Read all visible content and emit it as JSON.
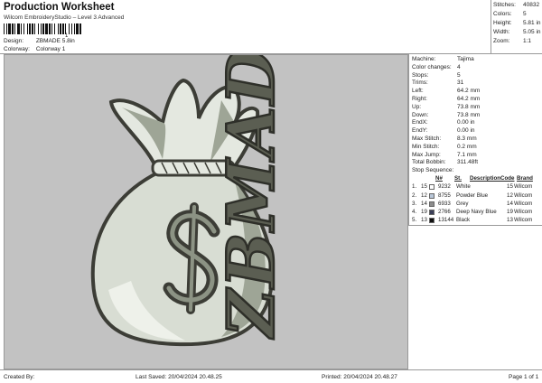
{
  "header": {
    "title": "Production Worksheet",
    "subtitle": "Wilcom EmbroideryStudio – Level 3 Advanced",
    "barcode_number": "1",
    "design_label": "Design:",
    "design_value": "ZBMADE 5.8in",
    "colorway_label": "Colorway:",
    "colorway_value": "Colorway 1"
  },
  "stats": [
    {
      "label": "Stitches:",
      "value": "40832"
    },
    {
      "label": "Colors:",
      "value": "5"
    },
    {
      "label": "Height:",
      "value": "5.81 in"
    },
    {
      "label": "Width:",
      "value": "5.05 in"
    },
    {
      "label": "Zoom:",
      "value": "1:1"
    }
  ],
  "machine_info": [
    {
      "label": "Machine:",
      "value": "Tajima"
    },
    {
      "label": "Color changes:",
      "value": "4"
    },
    {
      "label": "Stops:",
      "value": "5"
    },
    {
      "label": "Trims:",
      "value": "31"
    },
    {
      "label": "Left:",
      "value": "64.2 mm"
    },
    {
      "label": "Right:",
      "value": "64.2 mm"
    },
    {
      "label": "Up:",
      "value": "73.8 mm"
    },
    {
      "label": "Down:",
      "value": "73.8 mm"
    },
    {
      "label": "EndX:",
      "value": "0.00 in"
    },
    {
      "label": "EndY:",
      "value": "0.00 in"
    },
    {
      "label": "Max Stitch:",
      "value": "8.3 mm"
    },
    {
      "label": "Min Stitch:",
      "value": "0.2 mm"
    },
    {
      "label": "Max Jump:",
      "value": "7.1 mm"
    },
    {
      "label": "Total Bobbin:",
      "value": "311.48ft"
    }
  ],
  "stop_sequence": {
    "title": "Stop Sequence:",
    "headers": {
      "n": "N#",
      "st": "St.",
      "desc": "Description",
      "code": "Code",
      "brand": "Brand"
    },
    "rows": [
      {
        "idx": "1.",
        "n": "15",
        "st": "9232",
        "desc": "White",
        "code": "15",
        "brand": "Wilcom",
        "color": "#ffffff"
      },
      {
        "idx": "2.",
        "n": "12",
        "st": "8755",
        "desc": "Powder Blue",
        "code": "12",
        "brand": "Wilcom",
        "color": "#b9c7d9"
      },
      {
        "idx": "3.",
        "n": "14",
        "st": "6933",
        "desc": "Grey",
        "code": "14",
        "brand": "Wilcom",
        "color": "#8d8d8d"
      },
      {
        "idx": "4.",
        "n": "19",
        "st": "2766",
        "desc": "Deep Navy Blue",
        "code": "19",
        "brand": "Wilcom",
        "color": "#3b3f58"
      },
      {
        "idx": "5.",
        "n": "13",
        "st": "13144",
        "desc": "Black",
        "code": "13",
        "brand": "Wilcom",
        "color": "#111111"
      }
    ]
  },
  "design_text": "ZBMADE",
  "footer": {
    "created_by": "Created By:",
    "last_saved": "Last Saved: 20/04/2024 20.48.25",
    "printed": "Printed: 20/04/2024 20.48.27",
    "page": "Page 1 of 1"
  },
  "colors": {
    "canvas_bg": "#c2c2c2",
    "outline": "#3c3d36",
    "bag_light": "#e4e8e0",
    "bag_mid": "#9ea596",
    "bag_shade": "#6f7566"
  }
}
